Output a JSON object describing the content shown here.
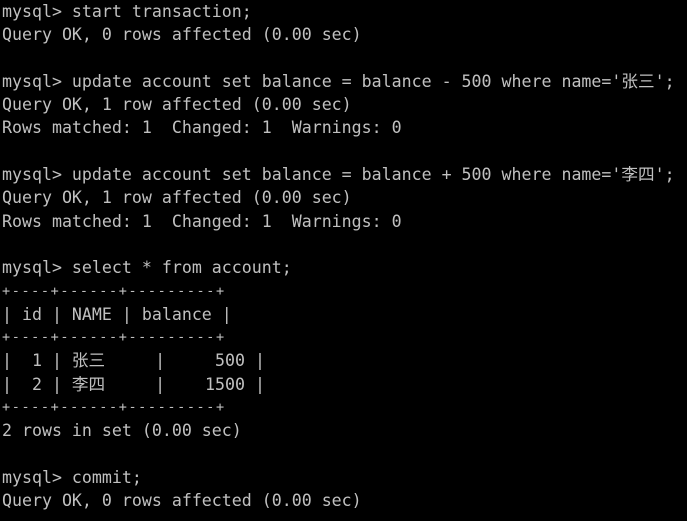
{
  "terminal": {
    "lines": [
      {
        "kind": "text",
        "text": "mysql> start transaction;"
      },
      {
        "kind": "text",
        "text": "Query OK, 0 rows affected (0.00 sec)"
      },
      {
        "kind": "blank"
      },
      {
        "kind": "text",
        "text": "mysql> update account set balance = balance - 500 where name='张三';"
      },
      {
        "kind": "text",
        "text": "Query OK, 1 row affected (0.00 sec)"
      },
      {
        "kind": "text",
        "text": "Rows matched: 1  Changed: 1  Warnings: 0"
      },
      {
        "kind": "blank"
      },
      {
        "kind": "text",
        "text": "mysql> update account set balance = balance + 500 where name='李四';"
      },
      {
        "kind": "text",
        "text": "Query OK, 1 row affected (0.00 sec)"
      },
      {
        "kind": "text",
        "text": "Rows matched: 1  Changed: 1  Warnings: 0"
      },
      {
        "kind": "blank"
      },
      {
        "kind": "text",
        "text": "mysql> select * from account;"
      },
      {
        "kind": "border",
        "text": "+----+------+---------+"
      },
      {
        "kind": "text",
        "text": "| id | NAME | balance |"
      },
      {
        "kind": "border",
        "text": "+----+------+---------+"
      },
      {
        "kind": "text",
        "text": "|  1 | 张三     |     500 |"
      },
      {
        "kind": "text",
        "text": "|  2 | 李四     |    1500 |"
      },
      {
        "kind": "border",
        "text": "+----+------+---------+"
      },
      {
        "kind": "text",
        "text": "2 rows in set (0.00 sec)"
      },
      {
        "kind": "blank"
      },
      {
        "kind": "text",
        "text": "mysql> commit;"
      },
      {
        "kind": "text",
        "text": "Query OK, 0 rows affected (0.00 sec)"
      }
    ]
  },
  "colors": {
    "background": "#000000",
    "foreground": "#c0c0c0"
  }
}
